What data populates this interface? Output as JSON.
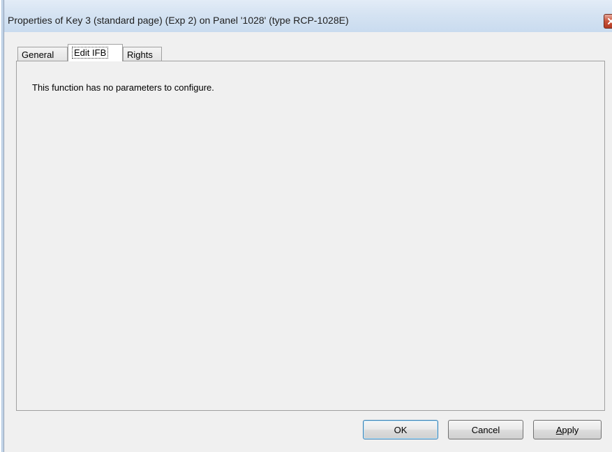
{
  "window": {
    "title": "Properties of Key 3 (standard page) (Exp 2) on Panel '1028' (type RCP-1028E)"
  },
  "tabs": [
    {
      "label": "General",
      "active": false
    },
    {
      "label": "Edit IFB",
      "active": true
    },
    {
      "label": "Rights",
      "active": false
    }
  ],
  "content": {
    "message": "This function has no parameters to configure."
  },
  "buttons": {
    "ok": "OK",
    "cancel": "Cancel",
    "apply": "Apply"
  },
  "colors": {
    "titlebar": "#d5e3f2",
    "dialog_bg": "#f0f0f0",
    "close_button": "#c7523a",
    "default_button_border": "#3c7fb1"
  },
  "icons": {
    "close": "close-icon"
  }
}
